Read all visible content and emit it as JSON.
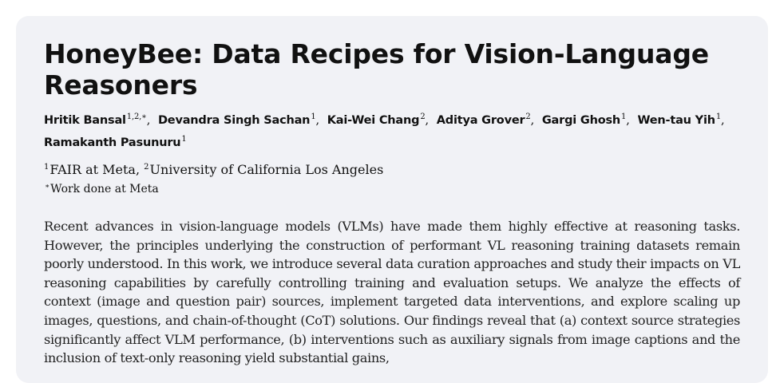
{
  "paper": {
    "title": "HoneyBee: Data Recipes for Vision-Language Reasoners",
    "authors": [
      {
        "name": "Hritik Bansal",
        "sup": "1,2,∗"
      },
      {
        "name": "Devandra Singh Sachan",
        "sup": "1"
      },
      {
        "name": "Kai-Wei Chang",
        "sup": "2"
      },
      {
        "name": "Aditya Grover",
        "sup": "2"
      },
      {
        "name": "Gargi Ghosh",
        "sup": "1"
      },
      {
        "name": "Wen-tau Yih",
        "sup": "1"
      },
      {
        "name": "Ramakanth Pasunuru",
        "sup": "1"
      }
    ],
    "affiliations": [
      {
        "sup": "1",
        "name": "FAIR at Meta"
      },
      {
        "sup": "2",
        "name": "University of California Los Angeles"
      }
    ],
    "note": {
      "sup": "∗",
      "text": "Work done at Meta"
    },
    "abstract": "Recent advances in vision-language models (VLMs) have made them highly effective at reasoning tasks. However, the principles underlying the construction of performant VL reasoning training datasets remain poorly understood. In this work, we introduce several data curation approaches and study their impacts on VL reasoning capabilities by carefully controlling training and evaluation setups. We analyze the effects of context (image and question pair) sources, implement targeted data interventions, and explore scaling up images, questions, and chain-of-thought (CoT) solutions. Our findings reveal that (a) context source strategies significantly affect VLM performance, (b) interventions such as auxiliary signals from image captions and the inclusion of text-only reasoning yield substantial gains,"
  }
}
